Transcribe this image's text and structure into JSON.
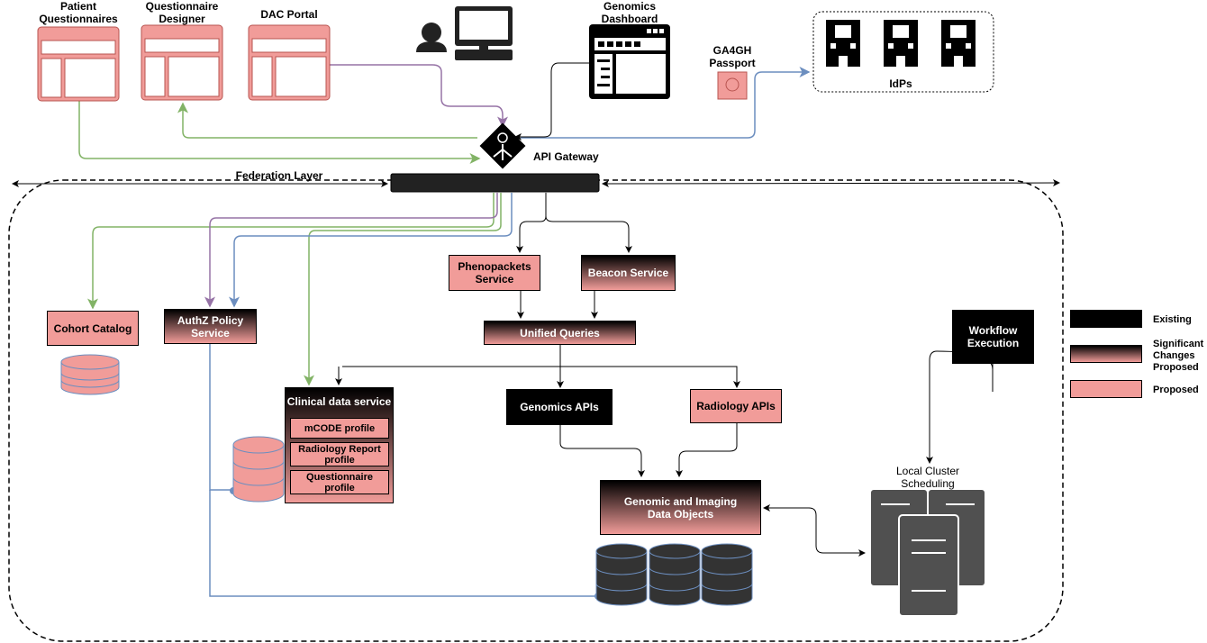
{
  "clients": {
    "patient_questionnaires": "Patient Questionnaires",
    "questionnaire_designer": "Questionnaire Designer",
    "dac_portal": "DAC Portal",
    "genomics_dashboard": "Genomics Dashboard"
  },
  "ga4gh_passport": "GA4GH Passport",
  "idps": "IdPs",
  "api_gateway": "API Gateway",
  "federation_layer": "Federation Layer",
  "services": {
    "phenopackets": "Phenopackets Service",
    "beacon": "Beacon Service",
    "unified_queries": "Unified Queries",
    "cohort_catalog": "Cohort Catalog",
    "authz": "AuthZ Policy Service",
    "clinical": "Clinical data service",
    "mcode": "mCODE profile",
    "radiology_report": "Radiology Report profile",
    "questionnaire_profile": "Questionnaire profile",
    "genomics_apis": "Genomics APIs",
    "radiology_apis": "Radiology APIs",
    "data_objects": "Genomic and Imaging Data Objects",
    "workflow": "Workflow Execution",
    "local_cluster": "Local Cluster Scheduling"
  },
  "legend": {
    "existing": "Existing",
    "significant": "Significant Changes Proposed",
    "proposed": "Proposed"
  },
  "colors": {
    "proposed": "#F19C99",
    "existing": "#000000",
    "green": "#82b366",
    "purple": "#9673a6",
    "blue": "#6c8ebf"
  }
}
